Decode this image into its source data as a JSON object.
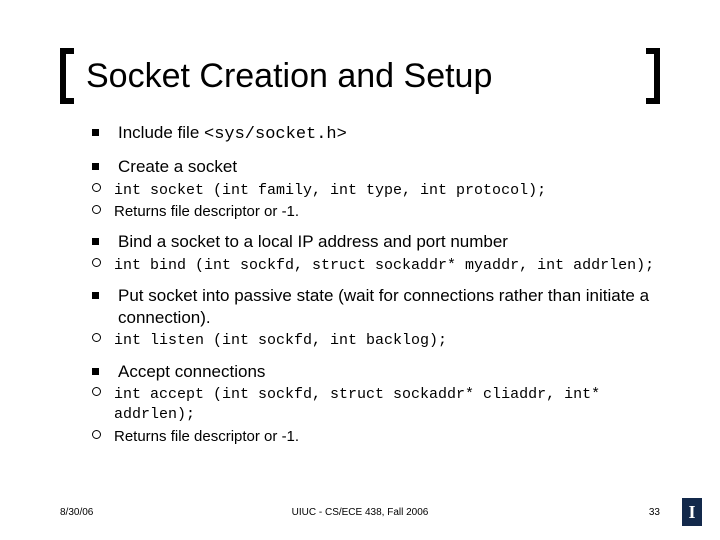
{
  "title": "Socket Creation and Setup",
  "bullets": [
    {
      "text_parts": [
        "Include file ",
        "<sys/socket.h>"
      ],
      "mono_idx": [
        1
      ],
      "sub": []
    },
    {
      "text_parts": [
        "Create a socket"
      ],
      "mono_idx": [],
      "sub": [
        {
          "parts": [
            "int socket (int family, int type, int protocol);"
          ],
          "mono_idx": [
            0
          ]
        },
        {
          "parts": [
            "Returns file descriptor or -1."
          ],
          "mono_idx": []
        }
      ]
    },
    {
      "text_parts": [
        "Bind a socket to a local IP address and port number"
      ],
      "mono_idx": [],
      "sub": [
        {
          "parts": [
            "int bind (int sockfd, struct sockaddr* myaddr, int addrlen);"
          ],
          "mono_idx": [
            0
          ]
        }
      ]
    },
    {
      "text_parts": [
        "Put socket into passive state (wait for connections rather than initiate a connection)."
      ],
      "mono_idx": [],
      "sub": [
        {
          "parts": [
            "int listen (int sockfd, int backlog);"
          ],
          "mono_idx": [
            0
          ]
        }
      ]
    },
    {
      "text_parts": [
        "Accept connections"
      ],
      "mono_idx": [],
      "sub": [
        {
          "parts": [
            "int accept (int sockfd, struct sockaddr* cliaddr, int* addrlen);"
          ],
          "mono_idx": [
            0
          ]
        },
        {
          "parts": [
            "Returns file descriptor or -1."
          ],
          "mono_idx": []
        }
      ]
    }
  ],
  "footer": {
    "date": "8/30/06",
    "center": "UIUC - CS/ECE 438, Fall 2006",
    "page": "33"
  }
}
